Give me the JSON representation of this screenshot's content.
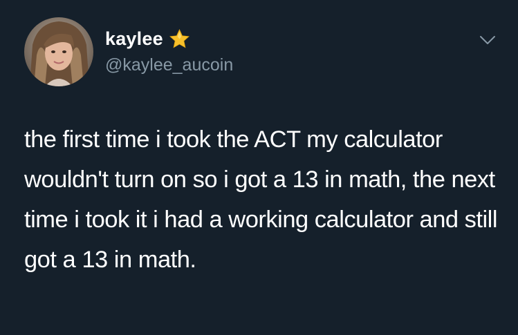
{
  "author": {
    "display_name": "kaylee",
    "handle": "@kaylee_aucoin",
    "name_emoji": "star-emoji",
    "avatar": "avatar-photo"
  },
  "menu": {
    "icon": "chevron-down-icon"
  },
  "tweet": {
    "text": "the first time i took the ACT my calculator wouldn't turn on so i got a 13 in math, the next time i took it i had a working calculator and still got a 13 in math."
  },
  "colors": {
    "background": "#15202b",
    "text": "#ffffff",
    "secondary": "#8899a6",
    "star": "#f7c02b"
  }
}
